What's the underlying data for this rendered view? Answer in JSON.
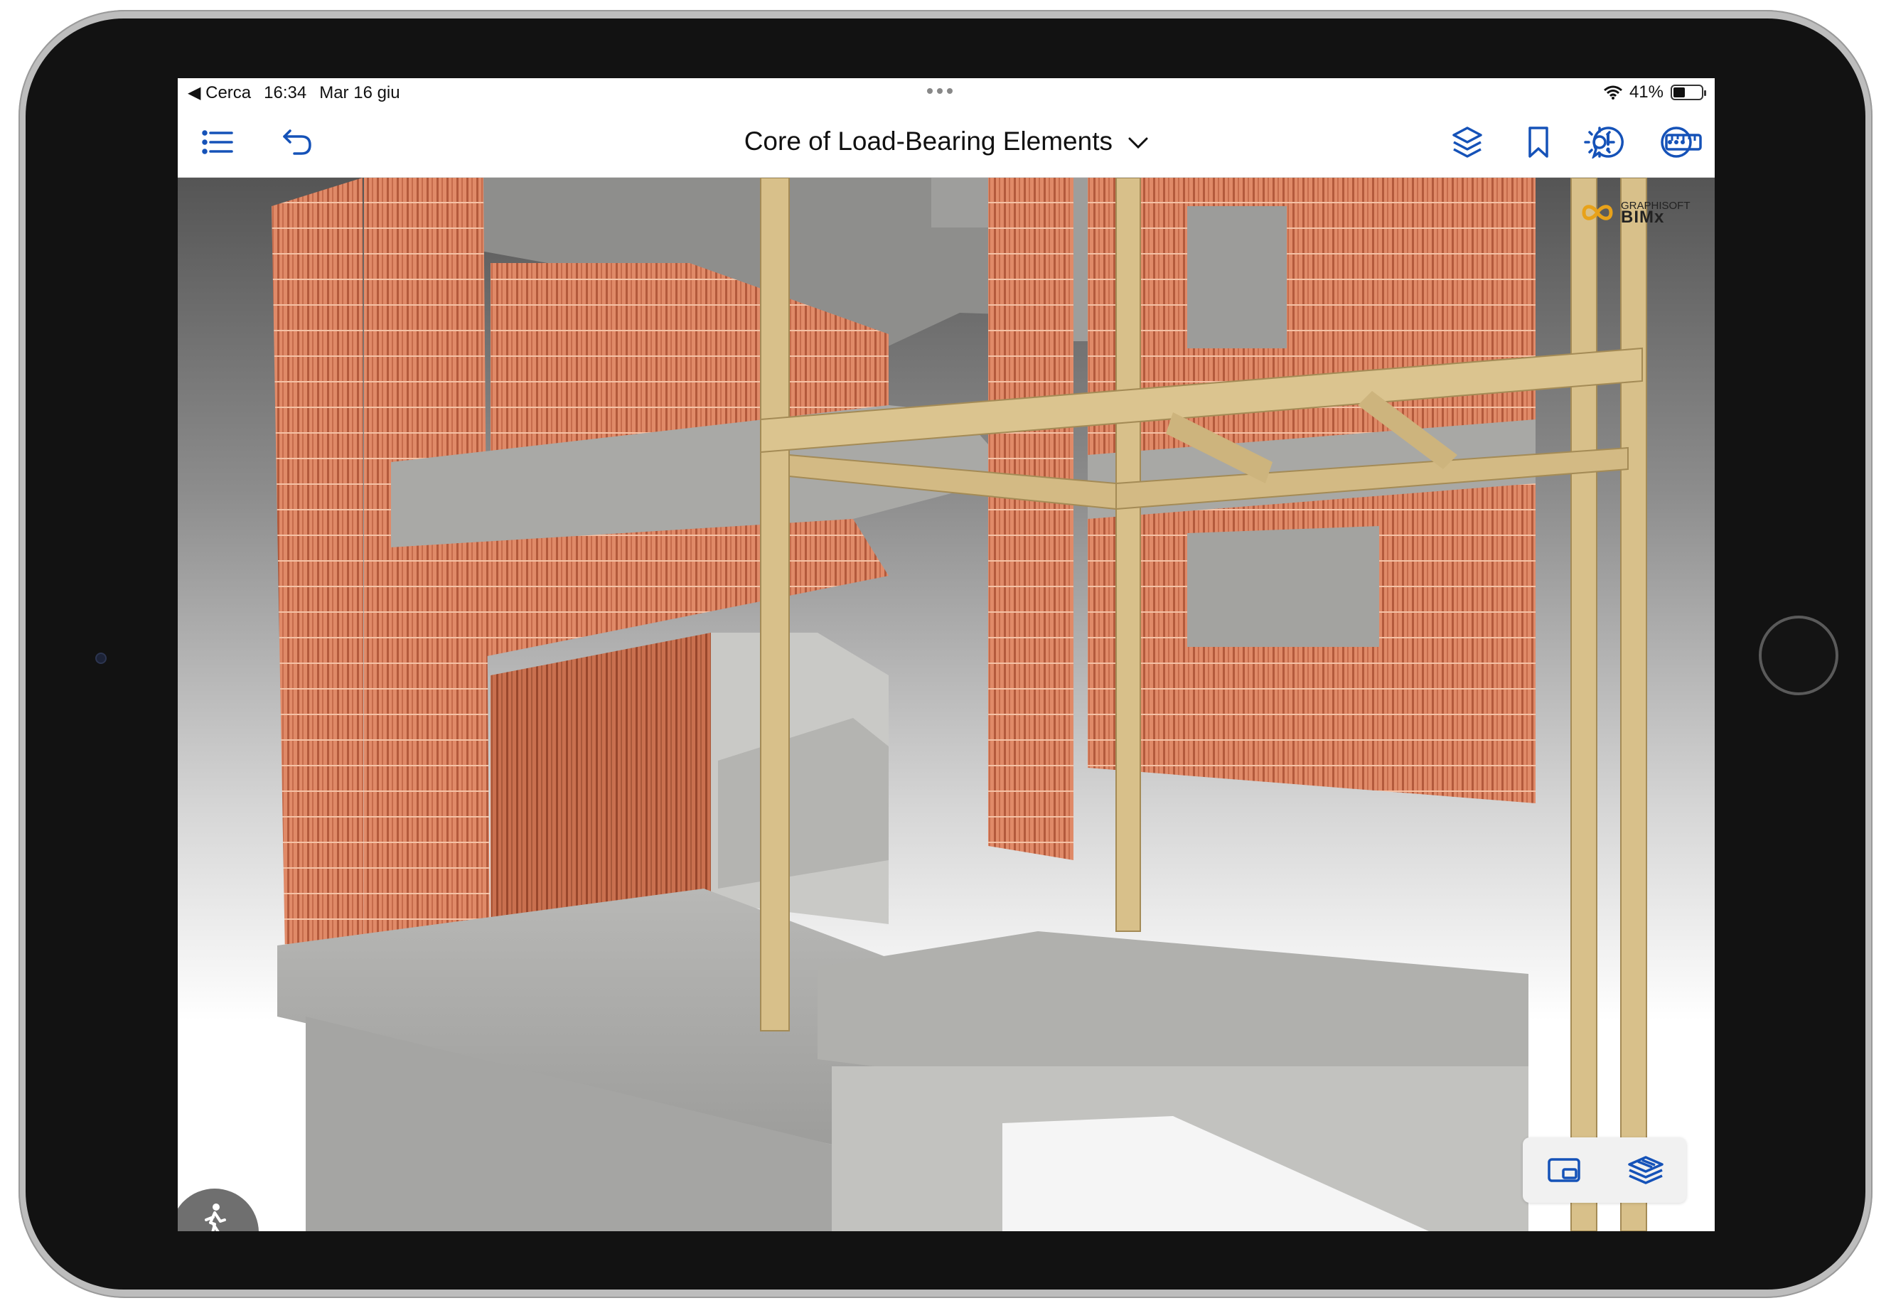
{
  "status": {
    "back_label": "◀ Cerca",
    "time": "16:34",
    "date": "Mar 16 giu",
    "battery": "41%"
  },
  "toolbar": {
    "title": "Core of Load-Bearing Elements",
    "icons": [
      "list-icon",
      "undo-icon",
      "layers-icon",
      "bookmark-icon",
      "issue-icon",
      "ruler-icon",
      "brightness-icon",
      "more-icon"
    ]
  },
  "branding": {
    "company": "GRAPHISOFT",
    "product": "BIMx"
  },
  "colors": {
    "accent": "#1552b8",
    "brick": "#d9785a",
    "concrete": "#a8a8a8",
    "timber": "#d8c08a"
  }
}
